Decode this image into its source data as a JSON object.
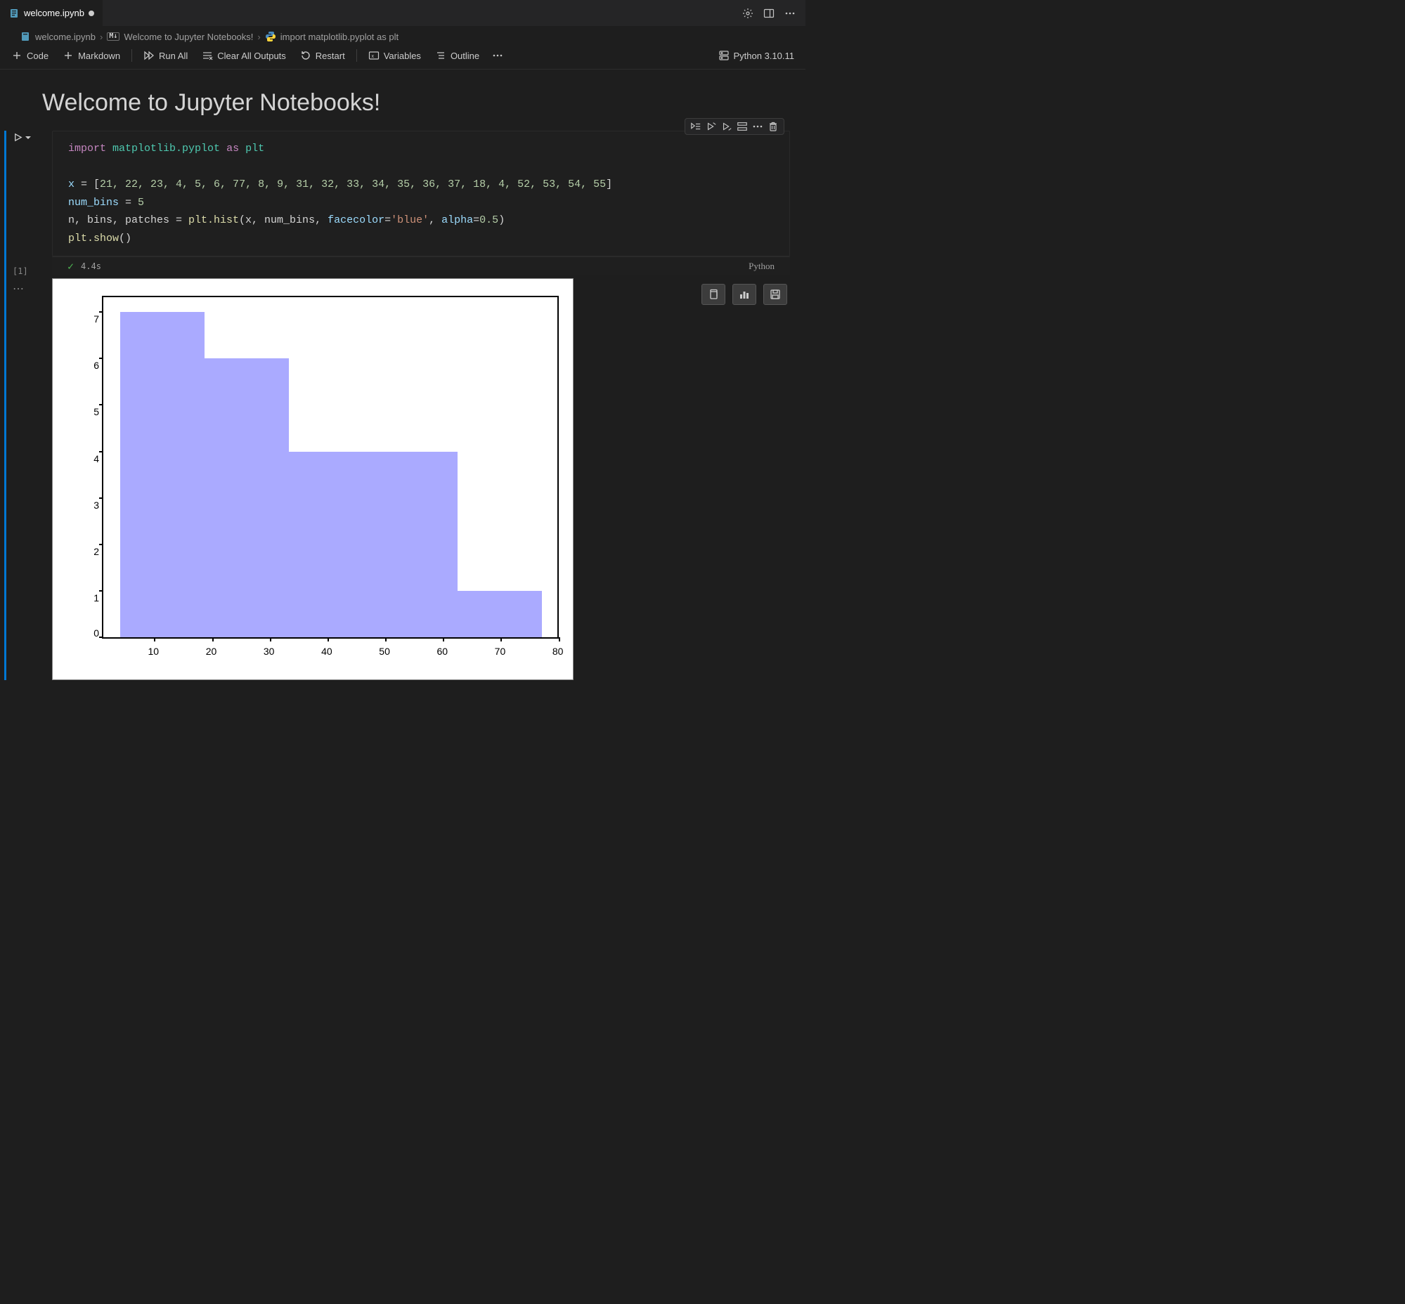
{
  "tab": {
    "filename": "welcome.ipynb",
    "dirty": true
  },
  "tab_actions": {
    "gear": "gear",
    "panel": "panel",
    "more": "more"
  },
  "breadcrumb": {
    "file": "welcome.ipynb",
    "section_label": "Welcome to Jupyter Notebooks!",
    "cell_label": "import matplotlib.pyplot as plt"
  },
  "toolbar": {
    "code": "Code",
    "markdown": "Markdown",
    "run_all": "Run All",
    "clear_outputs": "Clear All Outputs",
    "restart": "Restart",
    "variables": "Variables",
    "outline": "Outline",
    "kernel": "Python 3.10.11"
  },
  "heading": "Welcome to Jupyter Notebooks!",
  "cell": {
    "execution_count": "[1]",
    "code_lines": {
      "l1a": "import",
      "l1b": "matplotlib.pyplot",
      "l1c": "as",
      "l1d": "plt",
      "l3_var": "x",
      "l3_eq": " = [",
      "l3_vals": "21, 22, 23, 4, 5, 6, 77, 8, 9, 31, 32, 33, 34, 35, 36, 37, 18, 4, 52, 53, 54, 55",
      "l3_end": "]",
      "l4_var": "num_bins",
      "l4_rest": " = ",
      "l4_num": "5",
      "l5_lhs": "n, bins, patches = ",
      "l5_fn": "plt.hist",
      "l5_open": "(x, num_bins, ",
      "l5_kw1": "facecolor",
      "l5_eq1": "=",
      "l5_str": "'blue'",
      "l5_mid": ", ",
      "l5_kw2": "alpha",
      "l5_eq2": "=",
      "l5_num": "0.5",
      "l5_close": ")",
      "l6_fn": "plt.show",
      "l6_parens": "()"
    },
    "status_time": "4.4s",
    "language": "Python"
  },
  "chart_data": {
    "type": "bar",
    "title": "",
    "xlabel": "",
    "ylabel": "",
    "xlim": [
      4,
      77
    ],
    "ylim": [
      0,
      7
    ],
    "x_ticks": [
      10,
      20,
      30,
      40,
      50,
      60,
      70,
      80
    ],
    "y_ticks": [
      0,
      1,
      2,
      3,
      4,
      5,
      6,
      7
    ],
    "bin_edges": [
      4.0,
      18.6,
      33.2,
      47.8,
      62.4,
      77.0
    ],
    "values": [
      7,
      6,
      4,
      4,
      1
    ],
    "facecolor": "blue",
    "alpha": 0.5,
    "source_data_x": [
      21,
      22,
      23,
      4,
      5,
      6,
      77,
      8,
      9,
      31,
      32,
      33,
      34,
      35,
      36,
      37,
      18,
      4,
      52,
      53,
      54,
      55
    ],
    "num_bins": 5
  }
}
